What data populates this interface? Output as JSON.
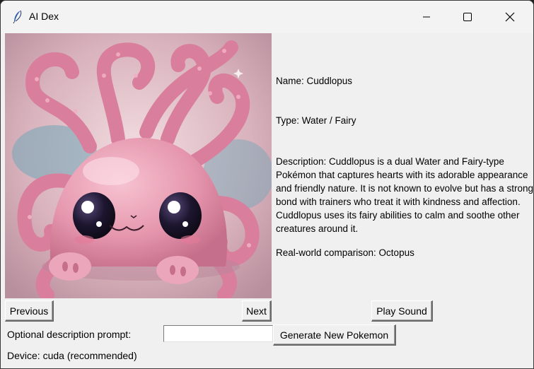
{
  "window": {
    "title": "AI Dex",
    "icon": "feather-icon",
    "controls": [
      "minimize-icon",
      "maximize-icon",
      "close-icon"
    ]
  },
  "pokemon": {
    "image": "pink-octopus-creature-illustration",
    "name_line": "Name: Cuddlopus",
    "type_line": "Type: Water / Fairy",
    "description_line": "Description:  Cuddlopus is a dual Water and Fairy-type Pokémon that captures hearts with its adorable appearance and friendly nature. It is not known to evolve but has a strong bond with trainers who treat it with kindness and affection. Cuddlopus uses its fairy abilities to calm and soothe other creatures around it.",
    "comparison_line": "Real-world comparison:  Octopus"
  },
  "controls": {
    "previous_label": "Previous",
    "next_label": "Next",
    "play_sound_label": "Play Sound",
    "prompt_label": "Optional description prompt:",
    "prompt_value": "",
    "generate_label": "Generate New Pokemon",
    "device_text": "Device: cuda (recommended)"
  }
}
